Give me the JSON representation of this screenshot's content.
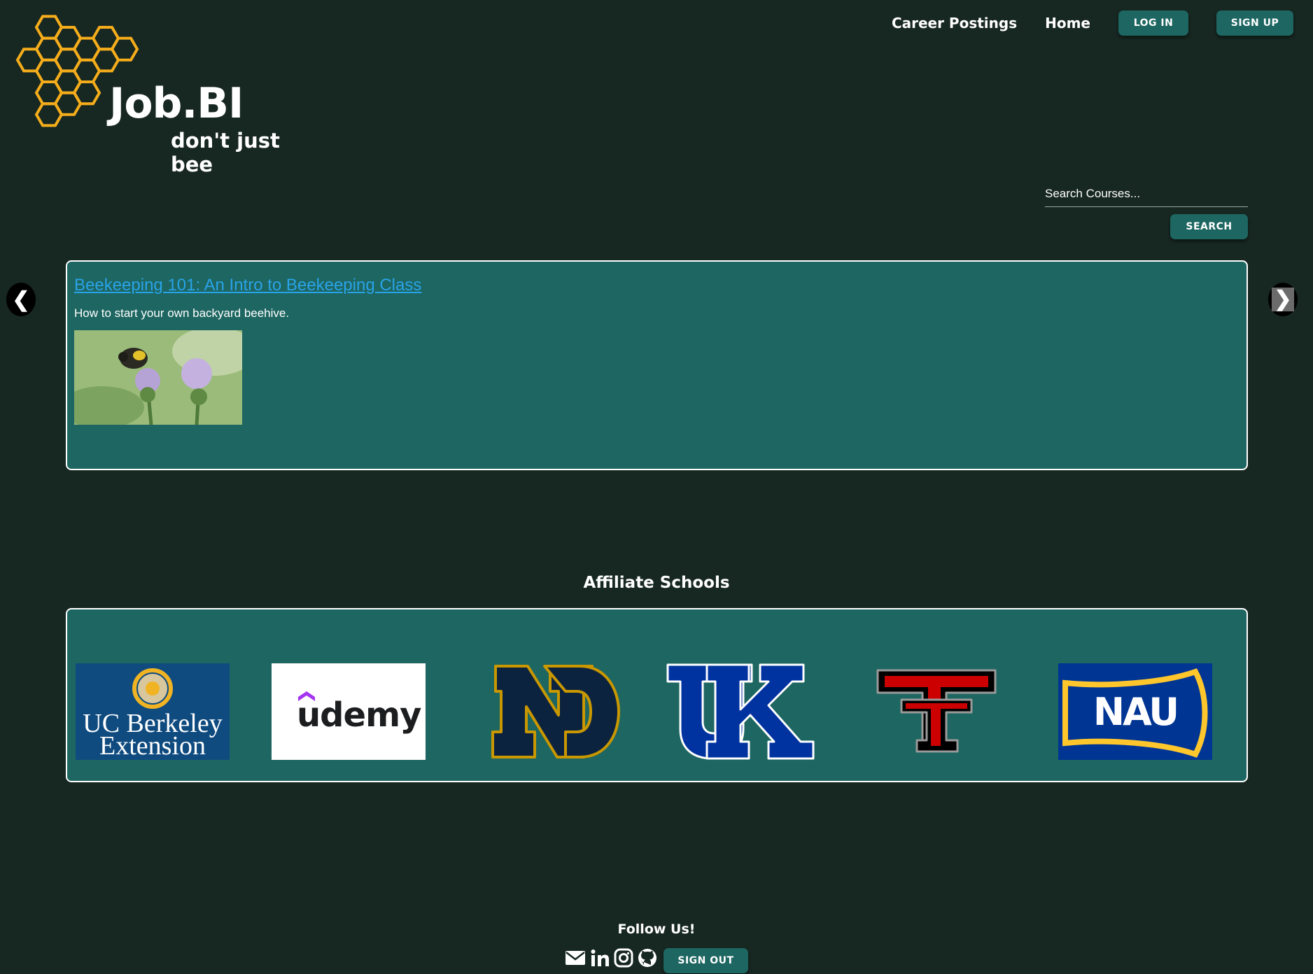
{
  "brand": {
    "name": "Job.BI",
    "tagline": "don't just bee",
    "accent_color": "#f5ad1b"
  },
  "nav": {
    "links": [
      "Career Postings",
      "Home"
    ],
    "login_label": "LOG IN",
    "signup_label": "SIGN UP"
  },
  "search": {
    "placeholder": "Search Courses...",
    "button_label": "SEARCH"
  },
  "carousel": {
    "prev_glyph": "❮",
    "next_glyph": "❯",
    "course": {
      "title": "Beekeeping 101: An Intro to Beekeeping Class",
      "description": "How to start your own backyard beehive."
    }
  },
  "affiliates": {
    "heading": "Affiliate Schools",
    "schools": [
      {
        "name": "UC Berkeley Extension",
        "line1": "UC Berkeley",
        "line2": "Extension"
      },
      {
        "name": "udemy"
      },
      {
        "name": "Notre Dame"
      },
      {
        "name": "UK"
      },
      {
        "name": "Texas Tech"
      },
      {
        "name": "NAU"
      }
    ]
  },
  "footer": {
    "follow_label": "Follow Us!",
    "social_icons": [
      "envelope-icon",
      "linkedin-icon",
      "instagram-icon",
      "github-icon"
    ],
    "signout_label": "SIGN OUT"
  },
  "colors": {
    "background": "#172722",
    "panel": "#1d6661",
    "button": "#1d6661",
    "link": "#29a3e8"
  }
}
